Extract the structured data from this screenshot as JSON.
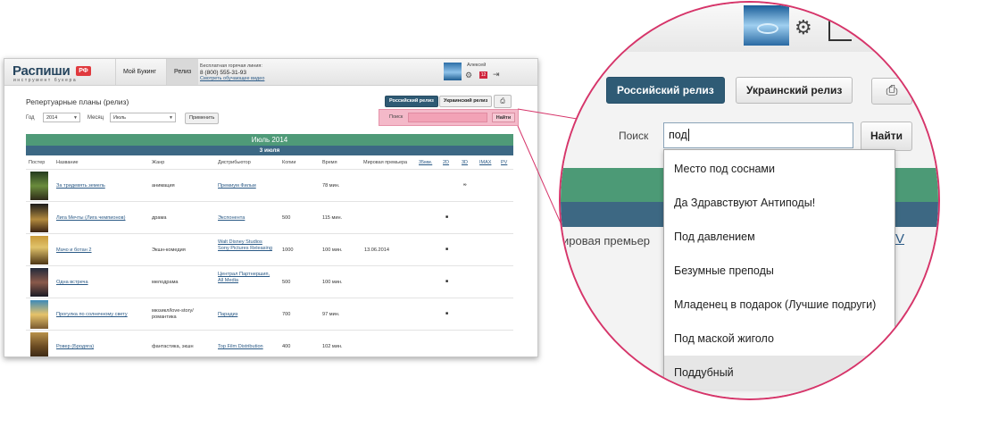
{
  "app": {
    "logo_text": "Распиши",
    "logo_badge": "РФ",
    "logo_tagline": "инструмент букера",
    "nav": [
      "Мой Букинг",
      "Релиз"
    ],
    "hotline_label": "Бесплатная горячая линия:",
    "hotline_phone": "8 (800) 555-31-93",
    "video_link": "Смотреть обучающее видео",
    "user_name": "Алексей",
    "notif_count": "12"
  },
  "page": {
    "title": "Репертуарные планы (релиз)",
    "release_buttons": [
      "Российский релиз",
      "Украинский релиз"
    ],
    "filters": {
      "year_label": "Год",
      "year_value": "2014",
      "month_label": "Месяц",
      "month_value": "Июль",
      "apply_label": "Применить"
    },
    "search": {
      "label": "Поиск",
      "button": "Найти",
      "value": "под"
    },
    "month_bar": "Июль 2014",
    "date_bar": "3 июля",
    "columns": [
      "Постер",
      "Название",
      "Жанр",
      "Дистрибьютор",
      "Копии",
      "Время",
      "Мировая премьера",
      "35мм.",
      "2D",
      "3D",
      "IMAX",
      "PV"
    ],
    "rows": [
      {
        "title": "За тридевять земель",
        "genre": "анимация",
        "distributor": "Премиум Фильм",
        "copies": "",
        "time": "78 мин.",
        "premiere": "",
        "fmt": "∞"
      },
      {
        "title": "Лига Мечты (Лига чемпионов)",
        "genre": "драма",
        "distributor": "Экспонента",
        "copies": "500",
        "time": "115 мин.",
        "premiere": "",
        "fmt": "■"
      },
      {
        "title": "Мачо и ботан 2",
        "genre": "Экшн-комедия",
        "distributor": "Walt Disney Studios Sony Pictures Releasing",
        "copies": "1000",
        "time": "100 мин.",
        "premiere": "13.06.2014",
        "fmt": "■"
      },
      {
        "title": "Одна встреча",
        "genre": "мелодрама",
        "distributor": "Централ Партнершип, All Media",
        "copies": "500",
        "time": "100 мин.",
        "premiere": "",
        "fmt": "■"
      },
      {
        "title": "Прогулка по солнечному свету",
        "genre": "мюзикл/love-story/ романтика",
        "distributor": "Парадиз",
        "copies": "700",
        "time": "97 мин.",
        "premiere": "",
        "fmt": "■"
      },
      {
        "title": "Ровер (Бродяга)",
        "genre": "фантастика, экшн",
        "distributor": "Top Film Distribution",
        "copies": "400",
        "time": "102 мин.",
        "premiere": "",
        "fmt": "■"
      }
    ]
  },
  "magnifier": {
    "release_buttons": [
      "Российский релиз",
      "Украинский релиз"
    ],
    "search_label": "Поиск",
    "search_value": "под",
    "find_button": "Найти",
    "partial_header": "ировая премьер",
    "partial_header_v": "V",
    "suggestions": [
      "Место под соснами",
      "Да Здравствуют Антиподы!",
      "Под давлением",
      "Безумные преподы",
      "Младенец в подарок (Лучшие подруги)",
      "Под маской жиголо",
      "Поддубный"
    ],
    "highlighted_index": 6
  },
  "colors": {
    "accent_pink": "#d6356a",
    "month_bar": "#4f9a78",
    "date_bar": "#3c6884",
    "primary_button": "#2f5a74"
  },
  "icons": [
    "gear-icon",
    "exit-icon",
    "print-icon",
    "dropdown-caret-icon",
    "avatar-water-drop"
  ]
}
